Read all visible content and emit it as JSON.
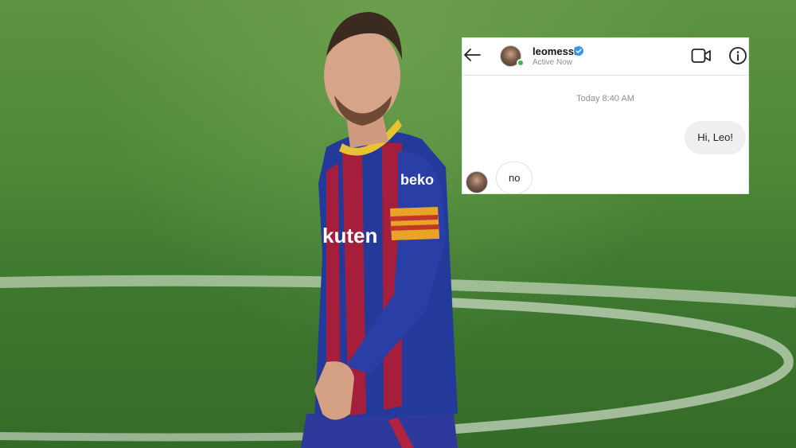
{
  "photo": {
    "jersey_sponsor_chest": "kuten",
    "jersey_sponsor_sleeve": "beko"
  },
  "chat": {
    "header": {
      "username": "leomessi",
      "status": "Active Now",
      "icons": [
        "back-arrow-icon",
        "verified-badge-icon",
        "video-call-icon",
        "info-icon"
      ]
    },
    "timestamp": "Today 8:40 AM",
    "messages": [
      {
        "from": "me",
        "text": "Hi, Leo!"
      },
      {
        "from": "leomessi",
        "text": "no"
      }
    ]
  },
  "colors": {
    "online": "#2fbf4a",
    "verified": "#3897f0",
    "outgoing_bubble": "#efefef",
    "pitch": "#4f8a38"
  }
}
